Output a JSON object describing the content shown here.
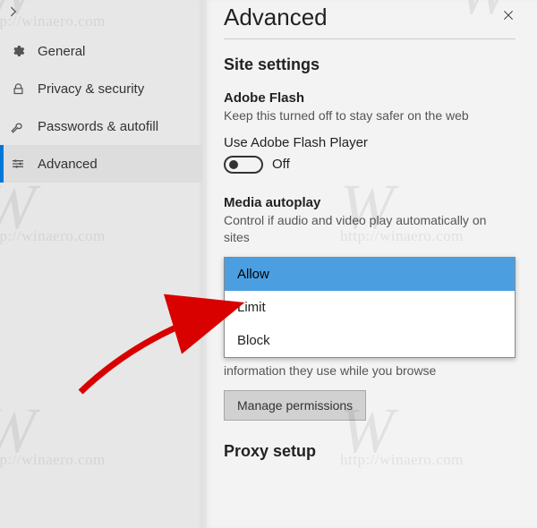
{
  "sidebar": {
    "items": [
      {
        "label": "General",
        "icon": "⚙"
      },
      {
        "label": "Privacy & security",
        "icon": "🔒"
      },
      {
        "label": "Passwords & autofill",
        "icon": "🔑"
      },
      {
        "label": "Advanced",
        "icon": "≡"
      }
    ]
  },
  "header": {
    "title": "Advanced"
  },
  "site_settings": {
    "title": "Site settings",
    "flash": {
      "title": "Adobe Flash",
      "desc": "Keep this turned off to stay safer on the web",
      "toggle_label": "Use Adobe Flash Player",
      "toggle_state": "Off"
    },
    "media": {
      "title": "Media autoplay",
      "desc": "Control if audio and video play automatically on sites",
      "options": [
        "Allow",
        "Limit",
        "Block"
      ],
      "selected": "Allow"
    },
    "fragment_below": "information they use while you browse",
    "manage_btn": "Manage permissions",
    "next_section": "Proxy setup"
  },
  "watermark": {
    "big": "W",
    "url": "http://winaero.com"
  }
}
